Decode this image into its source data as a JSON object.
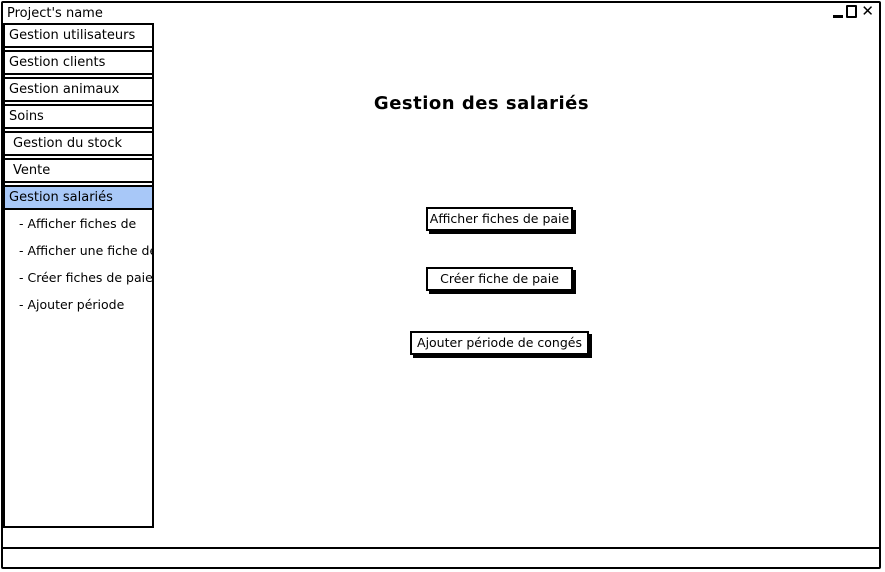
{
  "window": {
    "title": "Project's name"
  },
  "sidebar": {
    "items": [
      {
        "label": "Gestion utilisateurs"
      },
      {
        "label": "Gestion clients"
      },
      {
        "label": "Gestion animaux"
      },
      {
        "label": "Soins"
      },
      {
        "label": "Gestion du stock"
      },
      {
        "label": "Vente"
      },
      {
        "label": "Gestion salariés"
      }
    ],
    "subitems": [
      {
        "label": "- Afficher fiches de"
      },
      {
        "label": "- Afficher une fiche de"
      },
      {
        "label": "- Créer fiches de paie"
      },
      {
        "label": "- Ajouter période"
      }
    ]
  },
  "main": {
    "heading": "Gestion des salariés",
    "buttons": {
      "afficher": "Afficher fiches de paie",
      "creer": "Créer fiche de paie",
      "ajouter": "Ajouter période de congés"
    }
  },
  "colors": {
    "active": "#a8c8f8"
  }
}
